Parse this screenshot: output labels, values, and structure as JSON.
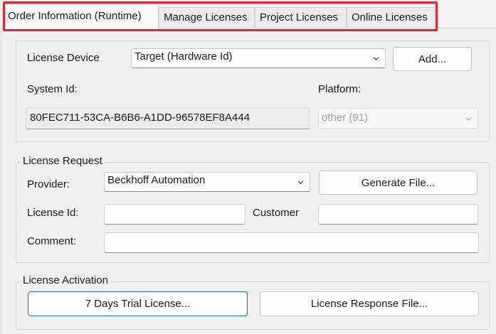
{
  "tabs": [
    {
      "label": "Order Information (Runtime)",
      "active": true
    },
    {
      "label": "Manage Licenses"
    },
    {
      "label": "Project Licenses"
    },
    {
      "label": "Online Licenses"
    }
  ],
  "device": {
    "license_device_label": "License Device",
    "license_device_value": "Target (Hardware Id)",
    "add_button": "Add...",
    "system_id_label": "System Id:",
    "system_id_value": "80FEC711-53CA-B6B6-A1DD-96578EF8A444",
    "platform_label": "Platform:",
    "platform_value": "other (91)"
  },
  "license_request": {
    "legend": "License Request",
    "provider_label": "Provider:",
    "provider_value": "Beckhoff Automation",
    "generate_button": "Generate File...",
    "license_id_label": "License Id:",
    "license_id_value": "",
    "customer_label": "Customer",
    "customer_value": "",
    "comment_label": "Comment:",
    "comment_value": ""
  },
  "license_activation": {
    "legend": "License Activation",
    "trial_button": "7 Days Trial License...",
    "response_button": "License Response File..."
  },
  "colors": {
    "highlight": "#e2262e",
    "focus_border": "#1b6fb5"
  }
}
